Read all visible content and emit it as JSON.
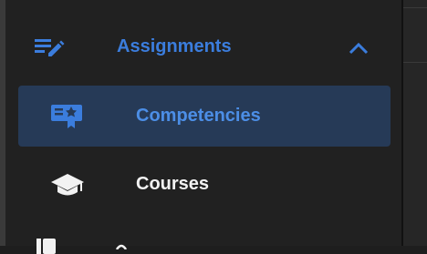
{
  "sidebar": {
    "items": [
      {
        "label": "Assignments",
        "icon": "assignment-edit-icon",
        "expanded": true,
        "color": "#3b7ddd"
      },
      {
        "label": "Competencies",
        "icon": "competency-badge-icon",
        "selected": true,
        "color": "#4c8ee6"
      },
      {
        "label": "Courses",
        "icon": "graduation-cap-icon",
        "color": "#f2f2f2"
      },
      {
        "label": "",
        "icon": "book-icon"
      }
    ]
  },
  "colors": {
    "background": "#212121",
    "accent": "#3b7ddd",
    "selected_bg": "#263a57"
  }
}
